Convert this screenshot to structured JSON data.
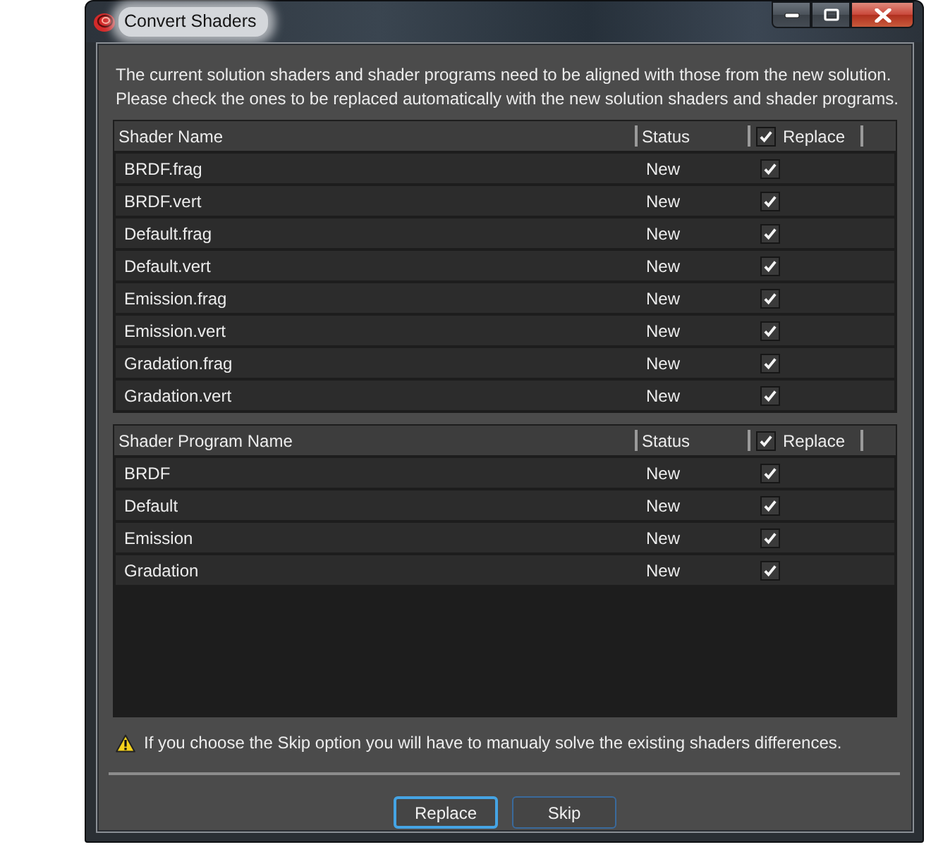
{
  "window": {
    "title": "Convert Shaders"
  },
  "message_lines": [
    "The current solution shaders and shader programs need to be aligned with those from the new solution.",
    "Please check the ones to be replaced automatically with the new solution shaders and shader programs."
  ],
  "shaders_table": {
    "columns": [
      {
        "label": "Shader Name"
      },
      {
        "label": "Status"
      },
      {
        "label": "Replace",
        "checked": true
      }
    ],
    "rows": [
      {
        "name": "BRDF.frag",
        "status": "New",
        "checked": true
      },
      {
        "name": "BRDF.vert",
        "status": "New",
        "checked": true
      },
      {
        "name": "Default.frag",
        "status": "New",
        "checked": true
      },
      {
        "name": "Default.vert",
        "status": "New",
        "checked": true
      },
      {
        "name": "Emission.frag",
        "status": "New",
        "checked": true
      },
      {
        "name": "Emission.vert",
        "status": "New",
        "checked": true
      },
      {
        "name": "Gradation.frag",
        "status": "New",
        "checked": true
      },
      {
        "name": "Gradation.vert",
        "status": "New",
        "checked": true
      }
    ]
  },
  "programs_table": {
    "columns": [
      {
        "label": "Shader Program Name"
      },
      {
        "label": "Status"
      },
      {
        "label": "Replace",
        "checked": true
      }
    ],
    "rows": [
      {
        "name": "BRDF",
        "status": "New",
        "checked": true
      },
      {
        "name": "Default",
        "status": "New",
        "checked": true
      },
      {
        "name": "Emission",
        "status": "New",
        "checked": true
      },
      {
        "name": "Gradation",
        "status": "New",
        "checked": true
      }
    ]
  },
  "warning": "If you choose the Skip option you will have to manualy solve the existing shaders differences.",
  "buttons": [
    {
      "label": "Replace",
      "focused": true
    },
    {
      "label": "Skip",
      "focused": false
    }
  ]
}
